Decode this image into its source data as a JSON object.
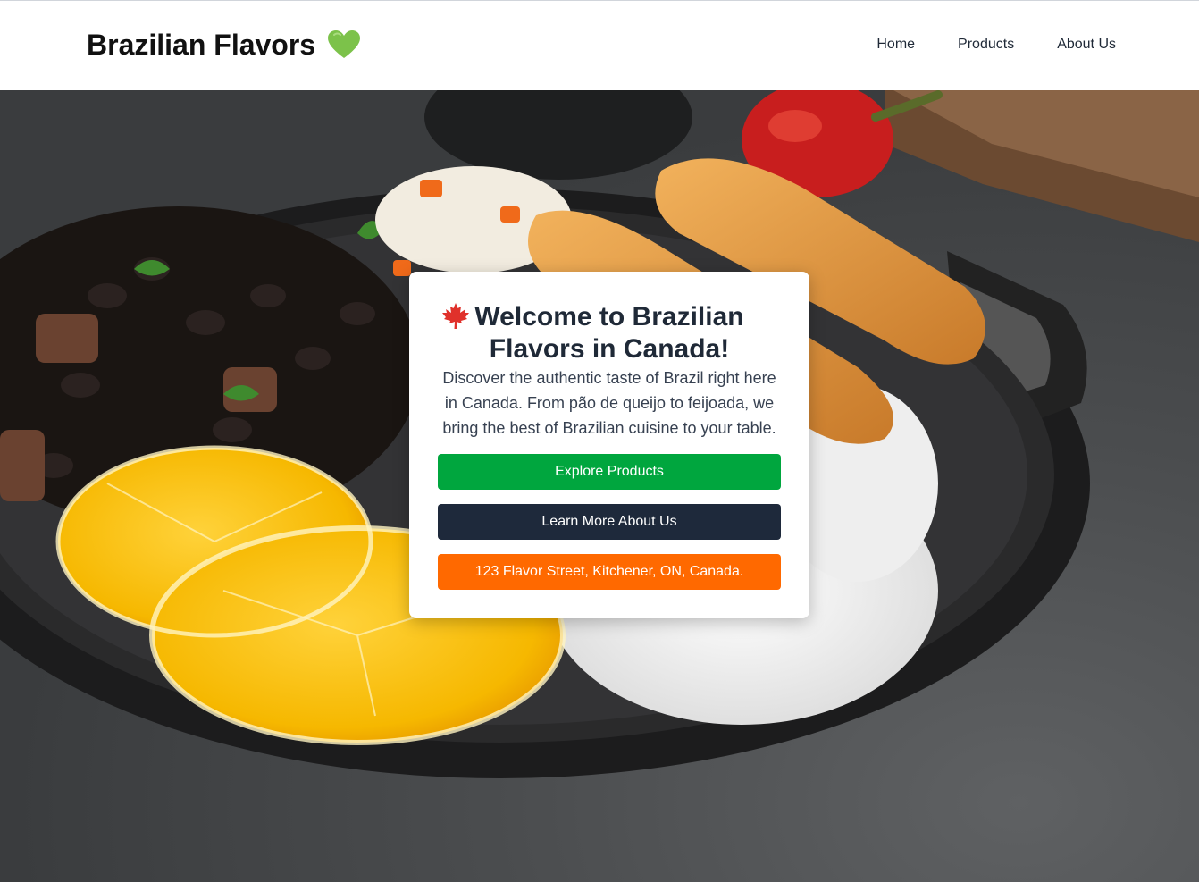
{
  "header": {
    "brand": "Brazilian Flavors",
    "brand_icon": "green-heart-icon",
    "nav": [
      {
        "label": "Home"
      },
      {
        "label": "Products"
      },
      {
        "label": "About Us"
      }
    ]
  },
  "hero": {
    "background_image": "brazilian-feijoada-plate-photo",
    "card": {
      "title": "Welcome to Brazilian Flavors in Canada!",
      "title_icon": "maple-leaf-icon",
      "description": "Discover the authentic taste of Brazil right here in Canada. From pão de queijo to feijoada, we bring the best of Brazilian cuisine to your table.",
      "buttons": [
        {
          "label": "Explore Products",
          "color": "#00a63e"
        },
        {
          "label": "Learn More About Us",
          "color": "#1e293b"
        },
        {
          "label": "123 Flavor Street, Kitchener, ON, Canada.",
          "color": "#ff6900"
        }
      ]
    }
  },
  "colors": {
    "brand_heart": "#7cc24a",
    "maple_leaf": "#e0312b"
  }
}
